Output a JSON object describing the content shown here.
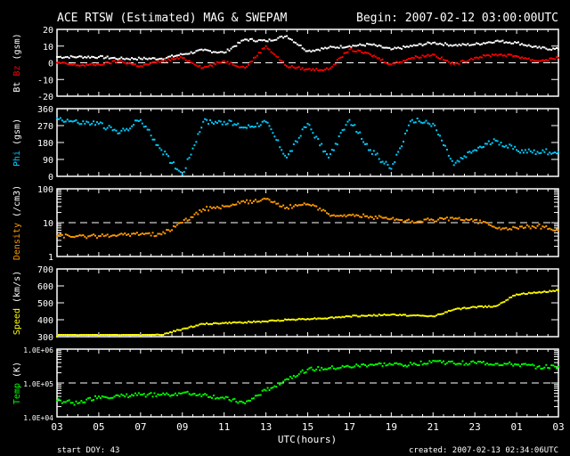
{
  "header": {
    "title": "ACE RTSW (Estimated) MAG & SWEPAM",
    "begin": "Begin: 2007-02-12 03:00:00UTC"
  },
  "footer": {
    "start_doy": "start DOY:  43",
    "created": "created: 2007-02-13 02:34:06UTC",
    "xlabel": "UTC(hours)"
  },
  "colors": {
    "bt": "#ffffff",
    "bz": "#ff0000",
    "phi": "#00ccff",
    "density": "#ff9900",
    "speed": "#ffff00",
    "temp": "#00ff00"
  },
  "chart_data": [
    {
      "type": "line",
      "title": "Bt Bz (gsm)",
      "ylabel_parts": [
        "Bt",
        "Bz",
        "(gsm)"
      ],
      "scale": "linear",
      "ylim": [
        -20,
        20
      ],
      "yticks": [
        "20",
        "10",
        "0",
        "-10",
        "-20"
      ],
      "ytick_values": [
        20,
        10,
        0,
        -10,
        -20
      ],
      "dashed_at": 0,
      "x": [
        0,
        1,
        2,
        3,
        4,
        5,
        6,
        7,
        8,
        9,
        10,
        11,
        12,
        13,
        14,
        15,
        16,
        17,
        18,
        19,
        20,
        21,
        22,
        23,
        24
      ],
      "series": [
        {
          "name": "Bt",
          "color": "#ffffff",
          "values": [
            3.5,
            3.5,
            3.5,
            2.5,
            2.5,
            2.5,
            5,
            7.5,
            6,
            14,
            13,
            16,
            7,
            9,
            10,
            11,
            8,
            10,
            12,
            10.5,
            11,
            13,
            12,
            9,
            8
          ]
        },
        {
          "name": "Bz",
          "color": "#ff0000",
          "values": [
            0,
            -1.5,
            -1,
            1,
            -2,
            1,
            3,
            -3,
            1,
            -3,
            10,
            -2,
            -4,
            -4,
            8,
            5,
            -1,
            3,
            5,
            -1,
            3,
            5,
            4,
            1,
            3
          ]
        }
      ]
    },
    {
      "type": "scatter",
      "title": "Phi (gsm)",
      "ylabel_parts": [
        "Phi",
        "(gsm)"
      ],
      "scale": "linear",
      "ylim": [
        0,
        360
      ],
      "yticks": [
        "360",
        "270",
        "180",
        "90",
        "0"
      ],
      "ytick_values": [
        360,
        270,
        180,
        90,
        0
      ],
      "x": [
        0,
        1,
        2,
        3,
        4,
        5,
        6,
        7,
        8,
        9,
        10,
        11,
        12,
        13,
        14,
        15,
        16,
        17,
        18,
        19,
        20,
        21,
        22,
        23,
        24
      ],
      "series": [
        {
          "name": "Phi",
          "color": "#00ccff",
          "values": [
            310,
            285,
            280,
            230,
            300,
            140,
            10,
            290,
            290,
            260,
            290,
            100,
            280,
            100,
            300,
            140,
            40,
            300,
            280,
            60,
            140,
            190,
            140,
            130,
            130
          ]
        }
      ]
    },
    {
      "type": "line",
      "title": "Density (/cm3)",
      "ylabel_parts": [
        "Density",
        "(/cm3)"
      ],
      "scale": "log",
      "ylim": [
        1,
        100
      ],
      "yticks": [
        "100",
        "10",
        "1"
      ],
      "ytick_values": [
        100,
        10,
        1
      ],
      "dashed_at": 10,
      "x": [
        0,
        1,
        2,
        3,
        4,
        5,
        6,
        7,
        8,
        9,
        10,
        11,
        12,
        13,
        14,
        15,
        16,
        17,
        18,
        19,
        20,
        21,
        22,
        23,
        24
      ],
      "series": [
        {
          "name": "Density",
          "color": "#ff9900",
          "values": [
            4,
            4,
            4,
            4.5,
            4.5,
            4.5,
            10,
            25,
            30,
            40,
            50,
            28,
            35,
            18,
            17,
            15,
            13,
            11,
            12,
            13,
            12,
            7,
            7,
            8,
            6
          ]
        }
      ]
    },
    {
      "type": "line",
      "title": "Speed (km/s)",
      "ylabel_parts": [
        "Speed",
        "(km/s)"
      ],
      "scale": "linear",
      "ylim": [
        300,
        700
      ],
      "yticks": [
        "700",
        "600",
        "500",
        "400",
        "300"
      ],
      "ytick_values": [
        700,
        600,
        500,
        400,
        300
      ],
      "x": [
        0,
        1,
        2,
        3,
        4,
        5,
        6,
        7,
        8,
        9,
        10,
        11,
        12,
        13,
        14,
        15,
        16,
        17,
        18,
        19,
        20,
        21,
        22,
        23,
        24
      ],
      "series": [
        {
          "name": "Speed",
          "color": "#ffff00",
          "values": [
            300,
            305,
            305,
            305,
            305,
            310,
            345,
            375,
            380,
            385,
            390,
            400,
            405,
            410,
            420,
            425,
            430,
            425,
            420,
            460,
            475,
            480,
            550,
            560,
            575
          ]
        }
      ]
    },
    {
      "type": "line",
      "title": "Temp (K)",
      "ylabel_parts": [
        "Temp",
        "(K)"
      ],
      "scale": "log",
      "ylim": [
        10000,
        1000000
      ],
      "yticks": [
        "1.0E+06",
        "1.0E+05",
        "1.0E+04"
      ],
      "ytick_values": [
        1000000,
        100000,
        10000
      ],
      "dashed_at": 100000,
      "x": [
        0,
        1,
        2,
        3,
        4,
        5,
        6,
        7,
        8,
        9,
        10,
        11,
        12,
        13,
        14,
        15,
        16,
        17,
        18,
        19,
        20,
        21,
        22,
        23,
        24
      ],
      "series": [
        {
          "name": "Temp",
          "color": "#00ff00",
          "values": [
            30000,
            25000,
            40000,
            40000,
            45000,
            45000,
            50000,
            45000,
            35000,
            25000,
            60000,
            130000,
            250000,
            270000,
            300000,
            350000,
            350000,
            350000,
            450000,
            380000,
            400000,
            370000,
            350000,
            300000,
            300000
          ]
        }
      ]
    }
  ],
  "xaxis": {
    "ticks": [
      "03",
      "05",
      "07",
      "09",
      "11",
      "13",
      "15",
      "17",
      "19",
      "21",
      "23",
      "01",
      "03"
    ],
    "hours_span": 24
  }
}
